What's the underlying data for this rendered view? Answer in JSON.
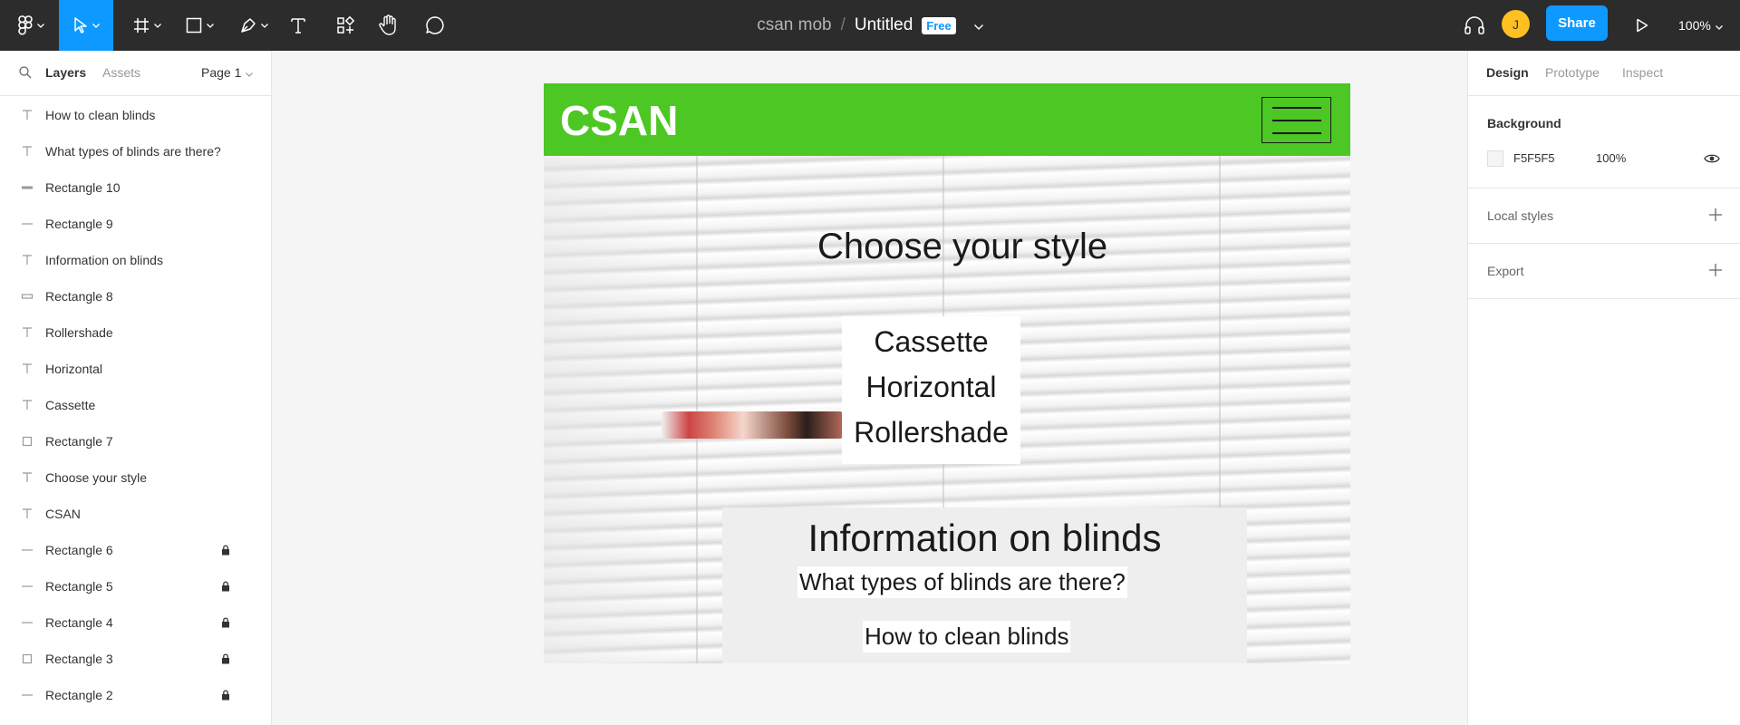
{
  "toolbar": {
    "project": "csan mob",
    "separator": "/",
    "file_name": "Untitled",
    "plan_badge": "Free",
    "avatar_initial": "J",
    "share_label": "Share",
    "zoom": "100%"
  },
  "left_panel": {
    "tabs": [
      "Layers",
      "Assets"
    ],
    "page": "Page 1",
    "layers": [
      {
        "name": "How to clean blinds",
        "icon": "text-icon",
        "locked": false
      },
      {
        "name": "What types of blinds are there?",
        "icon": "text-icon",
        "locked": false
      },
      {
        "name": "Rectangle 10",
        "icon": "thick-line-icon",
        "locked": false
      },
      {
        "name": "Rectangle 9",
        "icon": "line-icon",
        "locked": false
      },
      {
        "name": "Information on blinds",
        "icon": "text-icon",
        "locked": false
      },
      {
        "name": "Rectangle 8",
        "icon": "flat-rectangle-icon",
        "locked": false
      },
      {
        "name": "Rollershade",
        "icon": "text-icon",
        "locked": false
      },
      {
        "name": "Horizontal",
        "icon": "text-icon",
        "locked": false
      },
      {
        "name": "Cassette",
        "icon": "text-icon",
        "locked": false
      },
      {
        "name": "Rectangle 7",
        "icon": "rectangle-icon",
        "locked": false
      },
      {
        "name": "Choose your style",
        "icon": "text-icon",
        "locked": false
      },
      {
        "name": "CSAN",
        "icon": "text-icon",
        "locked": false
      },
      {
        "name": "Rectangle 6",
        "icon": "line-icon",
        "locked": true
      },
      {
        "name": "Rectangle 5",
        "icon": "line-icon",
        "locked": true
      },
      {
        "name": "Rectangle 4",
        "icon": "line-icon",
        "locked": true
      },
      {
        "name": "Rectangle 3",
        "icon": "rectangle-icon",
        "locked": true
      },
      {
        "name": "Rectangle 2",
        "icon": "line-icon",
        "locked": true
      }
    ]
  },
  "canvas": {
    "logo": "CSAN",
    "headline": "Choose your style",
    "styles": [
      "Cassette",
      "Horizontal",
      "Rollershade"
    ],
    "info_title": "Information on blinds",
    "info_links": [
      "What types of blinds are there?",
      "How to clean blinds"
    ],
    "header_color": "#4cc724"
  },
  "right_panel": {
    "tabs": [
      "Design",
      "Prototype",
      "Inspect"
    ],
    "background_title": "Background",
    "background_hex": "F5F5F5",
    "background_opacity": "100%",
    "local_styles": "Local styles",
    "export": "Export"
  },
  "colors": {
    "accent": "#0d99ff",
    "toolbar_bg": "#2c2c2c",
    "avatar": "#ffc021"
  }
}
